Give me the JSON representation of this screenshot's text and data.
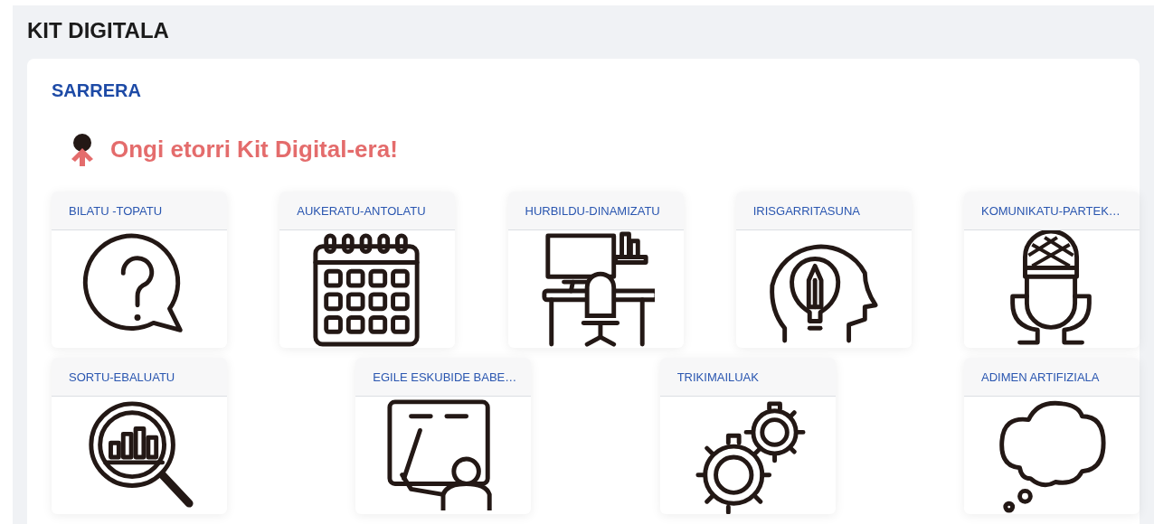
{
  "page": {
    "title": "KIT DIGITALA"
  },
  "section": {
    "heading": "SARRERA",
    "welcome": "Ongi etorri Kit Digital-era!"
  },
  "rows": [
    {
      "cards": [
        {
          "title": "BILATU -TOPATU"
        },
        {
          "title": "AUKERATU-ANTOLATU"
        },
        {
          "title": "HURBILDU-DINAMIZATU"
        },
        {
          "title": "IRISGARRITASUNA"
        },
        {
          "title": "KOMUNIKATU-PARTEK…"
        }
      ]
    },
    {
      "cards": [
        {
          "title": "SORTU-EBALUATU"
        },
        {
          "title": "EGILE ESKUBIDE BABE…"
        },
        {
          "title": "TRIKIMAILUAK"
        },
        {
          "title": "ADIMEN ARTIFIZIALA"
        }
      ]
    }
  ]
}
